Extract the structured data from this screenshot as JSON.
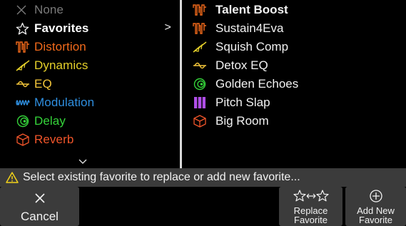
{
  "categories": [
    {
      "label": "None",
      "icon": "x-icon",
      "color": "#7a7a7a",
      "bold": false
    },
    {
      "label": "Favorites",
      "icon": "star-icon",
      "color": "#ffffff",
      "bold": true
    },
    {
      "label": "Distortion",
      "icon": "distortion-icon",
      "color": "#f26a1b",
      "bold": false
    },
    {
      "label": "Dynamics",
      "icon": "dynamics-icon",
      "color": "#e6d12a",
      "bold": false
    },
    {
      "label": "EQ",
      "icon": "eq-icon",
      "color": "#f4c63a",
      "bold": false
    },
    {
      "label": "Modulation",
      "icon": "modulation-icon",
      "color": "#2f8fe0",
      "bold": false
    },
    {
      "label": "Delay",
      "icon": "delay-icon",
      "color": "#35d43a",
      "bold": false
    },
    {
      "label": "Reverb",
      "icon": "reverb-icon",
      "color": "#f0552a",
      "bold": false
    }
  ],
  "favorites_chevron": ">",
  "presets": [
    {
      "label": "Talent Boost",
      "icon": "distortion-icon",
      "color": "#f26a1b",
      "bold": true
    },
    {
      "label": "Sustain4Eva",
      "icon": "distortion-icon",
      "color": "#f26a1b",
      "bold": false
    },
    {
      "label": "Squish Comp",
      "icon": "dynamics-icon",
      "color": "#e6d12a",
      "bold": false
    },
    {
      "label": "Detox EQ",
      "icon": "eq-icon",
      "color": "#f4c63a",
      "bold": false
    },
    {
      "label": "Golden Echoes",
      "icon": "delay-icon",
      "color": "#35d43a",
      "bold": false
    },
    {
      "label": "Pitch Slap",
      "icon": "pitch-icon",
      "color": "#b04ee8",
      "bold": false
    },
    {
      "label": "Big Room",
      "icon": "reverb-icon",
      "color": "#f0552a",
      "bold": false
    }
  ],
  "status": {
    "message": "Select existing favorite to replace or add new favorite...",
    "icon": "warning-icon",
    "icon_color": "#f2d21a"
  },
  "buttons": {
    "cancel": {
      "icon": "x-icon",
      "label": "Cancel"
    },
    "replace": {
      "icon": "star-swap-icon",
      "line1": "Replace",
      "line2": "Favorite"
    },
    "add": {
      "icon": "plus-circle-icon",
      "line1": "Add New",
      "line2": "Favorite"
    }
  }
}
